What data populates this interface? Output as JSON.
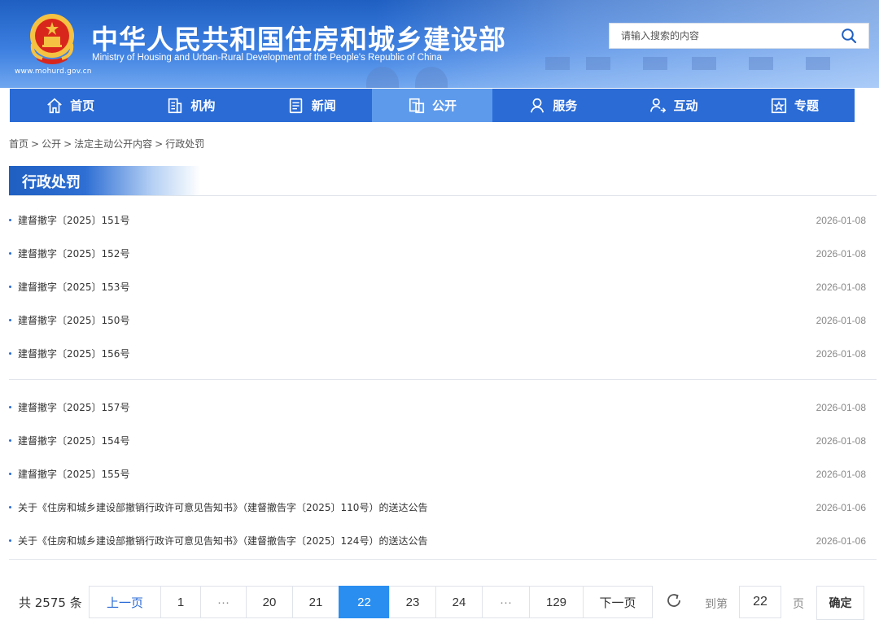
{
  "header": {
    "title_cn": "中华人民共和国住房和城乡建设部",
    "title_en": "Ministry of Housing and Urban-Rural Development of the People's Republic of China",
    "site_url": "www.mohurd.gov.cn",
    "search_placeholder": "请输入搜索的内容"
  },
  "nav": [
    {
      "label": "首页",
      "icon": "home-icon"
    },
    {
      "label": "机构",
      "icon": "building-icon"
    },
    {
      "label": "新闻",
      "icon": "news-icon"
    },
    {
      "label": "公开",
      "icon": "document-icon",
      "active": true
    },
    {
      "label": "服务",
      "icon": "service-icon"
    },
    {
      "label": "互动",
      "icon": "interaction-icon"
    },
    {
      "label": "专题",
      "icon": "topic-icon"
    }
  ],
  "breadcrumb": [
    "首页",
    "公开",
    "法定主动公开内容",
    "行政处罚"
  ],
  "section_title": "行政处罚",
  "items": [
    {
      "title": "建督撤字〔2025〕151号",
      "date": "2026-01-08"
    },
    {
      "title": "建督撤字〔2025〕152号",
      "date": "2026-01-08"
    },
    {
      "title": "建督撤字〔2025〕153号",
      "date": "2026-01-08"
    },
    {
      "title": "建督撤字〔2025〕150号",
      "date": "2026-01-08"
    },
    {
      "title": "建督撤字〔2025〕156号",
      "date": "2026-01-08"
    },
    {
      "title": "建督撤字〔2025〕157号",
      "date": "2026-01-08"
    },
    {
      "title": "建督撤字〔2025〕154号",
      "date": "2026-01-08"
    },
    {
      "title": "建督撤字〔2025〕155号",
      "date": "2026-01-08"
    },
    {
      "title": "关于《住房和城乡建设部撤销行政许可意见告知书》（建督撤告字〔2025〕110号）的送达公告",
      "date": "2026-01-06"
    },
    {
      "title": "关于《住房和城乡建设部撤销行政许可意见告知书》（建督撤告字〔2025〕124号）的送达公告",
      "date": "2026-01-06"
    }
  ],
  "pagination": {
    "total": "共 2575 条",
    "prev": "上一页",
    "next": "下一页",
    "pages": [
      "1",
      "···",
      "20",
      "21",
      "22",
      "23",
      "24",
      "···",
      "129"
    ],
    "current": "22",
    "goto_label": "到第",
    "goto_value": "22",
    "page_unit": "页",
    "confirm": "确定"
  },
  "colors": {
    "primary": "#2a6bd6",
    "active_nav": "#5d9aec",
    "current_page": "#2a8ef0"
  }
}
